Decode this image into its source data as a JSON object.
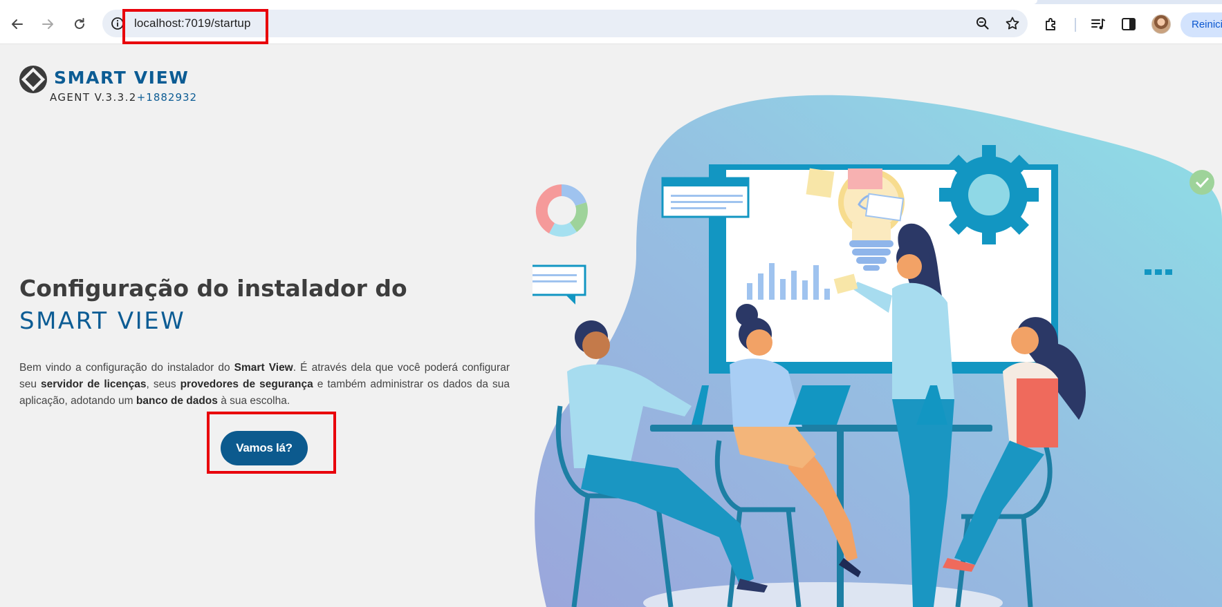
{
  "browser": {
    "url": "localhost:7019/startup",
    "profile_button_label": "Reinici",
    "icons": [
      "back-arrow-icon",
      "forward-arrow-icon",
      "reload-icon",
      "site-info-icon",
      "zoom-icon",
      "bookmark-star-icon",
      "extensions-puzzle-icon",
      "media-controls-icon",
      "side-panel-icon"
    ]
  },
  "brand": {
    "title": "SMART VIEW",
    "version_label": "AGENT V.3.3.2",
    "build": "+1882932"
  },
  "hero": {
    "headline": "Configuração do instalador do",
    "headline_brand": "SMART VIEW",
    "intro_parts": [
      "Bem vindo a configuração do instalador do ",
      "Smart View",
      ". É através dela que você poderá configurar seu ",
      "servidor de licenças",
      ", seus ",
      "provedores de segurança",
      " e também administrar os dados da sua aplicação, adotando um ",
      "banco de dados",
      " à sua escolha."
    ],
    "cta_label": "Vamos lá?"
  },
  "colors": {
    "brand_blue": "#0c5c94",
    "button_blue": "#0c5a8e",
    "annotation_red": "#e8000b",
    "page_bg": "#f1f1f1"
  }
}
